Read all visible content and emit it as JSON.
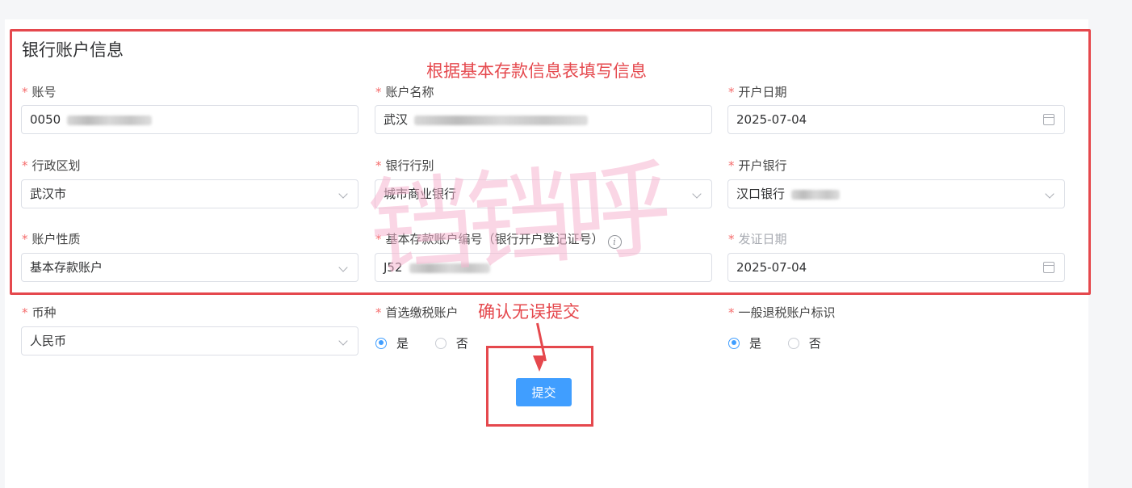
{
  "section_title": "银行账户信息",
  "hint_banner": "根据基本存款信息表填写信息",
  "confirm_text": "确认无误提交",
  "submit_label": "提交",
  "watermark": "铛铛呼",
  "colors": {
    "accent": "#409eff",
    "annotation": "#e5484d",
    "required": "#f56c6c",
    "watermark": "#f7b6d0"
  },
  "fields": {
    "account_no": {
      "label": "账号",
      "required": true,
      "value": "0050"
    },
    "account_name": {
      "label": "账户名称",
      "required": true,
      "value": "武汉"
    },
    "open_date": {
      "label": "开户日期",
      "required": true,
      "value": "2025-07-04",
      "icon": "calendar-icon"
    },
    "district": {
      "label": "行政区划",
      "required": true,
      "value": "武汉市",
      "icon": "chevron-down-icon"
    },
    "bank_type": {
      "label": "银行行别",
      "required": true,
      "value": "城市商业银行",
      "icon": "chevron-down-icon"
    },
    "open_bank": {
      "label": "开户银行",
      "required": true,
      "value": "汉口银行",
      "icon": "chevron-down-icon"
    },
    "account_nature": {
      "label": "账户性质",
      "required": true,
      "value": "基本存款账户",
      "icon": "chevron-down-icon"
    },
    "basic_account_no": {
      "label": "基本存款账户编号（银行开户登记证号）",
      "required": true,
      "value": "J52",
      "info_icon": "i"
    },
    "issue_date": {
      "label": "发证日期",
      "required": true,
      "value": "2025-07-04",
      "icon": "calendar-icon"
    },
    "currency": {
      "label": "币种",
      "required": true,
      "value": "人民币",
      "icon": "chevron-down-icon"
    },
    "preferred_tax": {
      "label": "首选缴税账户",
      "required": true,
      "options": [
        "是",
        "否"
      ],
      "selected": "是"
    },
    "refund_flag": {
      "label": "一般退税账户标识",
      "required": true,
      "options": [
        "是",
        "否"
      ],
      "selected": "是"
    }
  }
}
